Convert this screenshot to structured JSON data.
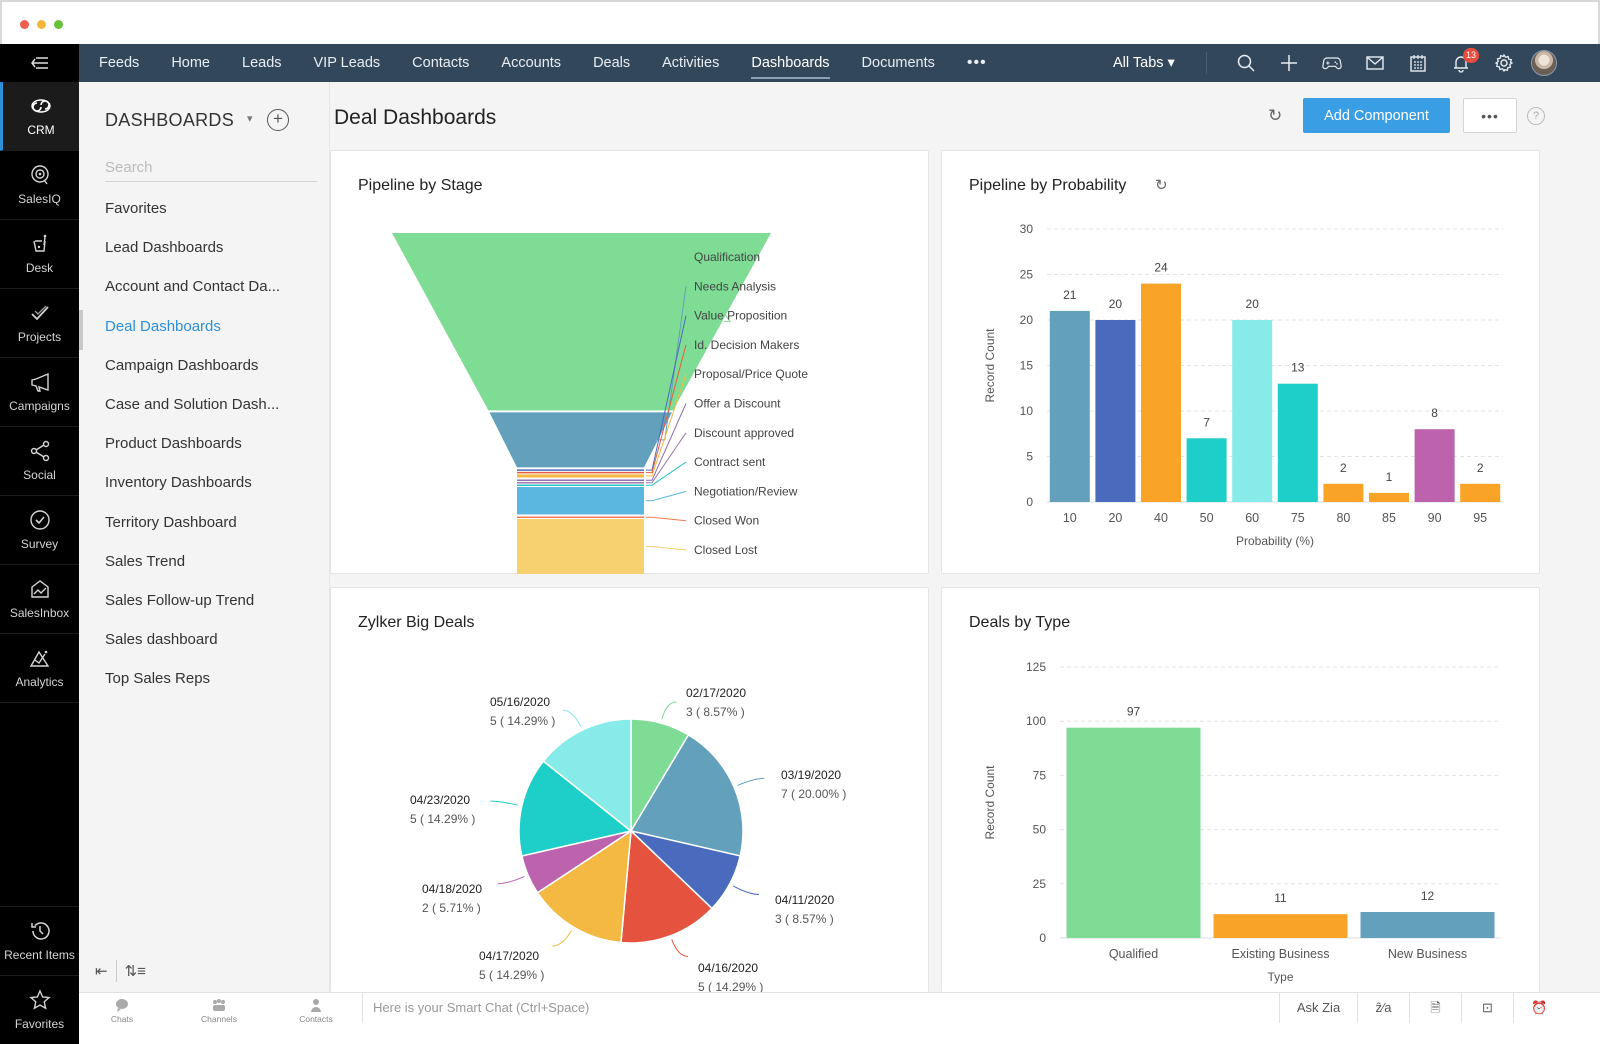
{
  "window": {
    "traffic_lights": [
      "close",
      "minimize",
      "maximize"
    ]
  },
  "app_sidebar": {
    "menu_icon": "menu-collapse-icon",
    "items": [
      {
        "label": "CRM",
        "icon": "crm-icon",
        "active": true
      },
      {
        "label": "SalesIQ",
        "icon": "salesiq-icon",
        "active": false
      },
      {
        "label": "Desk",
        "icon": "desk-icon",
        "active": false
      },
      {
        "label": "Projects",
        "icon": "projects-icon",
        "active": false
      },
      {
        "label": "Campaigns",
        "icon": "campaigns-icon",
        "active": false
      },
      {
        "label": "Social",
        "icon": "social-icon",
        "active": false
      },
      {
        "label": "Survey",
        "icon": "survey-icon",
        "active": false
      },
      {
        "label": "SalesInbox",
        "icon": "salesinbox-icon",
        "active": false
      },
      {
        "label": "Analytics",
        "icon": "analytics-icon",
        "active": false
      }
    ],
    "bottom_items": [
      {
        "label": "Recent Items",
        "icon": "history-icon"
      },
      {
        "label": "Favorites",
        "icon": "star-icon"
      }
    ]
  },
  "topnav": {
    "tabs": [
      {
        "label": "Feeds",
        "active": false
      },
      {
        "label": "Home",
        "active": false
      },
      {
        "label": "Leads",
        "active": false
      },
      {
        "label": "VIP Leads",
        "active": false
      },
      {
        "label": "Contacts",
        "active": false
      },
      {
        "label": "Accounts",
        "active": false
      },
      {
        "label": "Deals",
        "active": false
      },
      {
        "label": "Activities",
        "active": false
      },
      {
        "label": "Dashboards",
        "active": true
      },
      {
        "label": "Documents",
        "active": false
      }
    ],
    "more_label": "•••",
    "all_tabs_label": "All Tabs ▾",
    "icons": [
      "search-icon",
      "plus-icon",
      "gamepad-icon",
      "mail-icon",
      "calendar-icon",
      "bell-icon",
      "gear-icon",
      "avatar"
    ],
    "notification_count": "13"
  },
  "dashboards_panel": {
    "header": "DASHBOARDS",
    "caret": "▾",
    "add": "+",
    "search_placeholder": "Search",
    "search_value": "",
    "items": [
      {
        "label": "Favorites",
        "active": false
      },
      {
        "label": "Lead Dashboards",
        "active": false
      },
      {
        "label": "Account and Contact Da...",
        "active": false
      },
      {
        "label": "Deal Dashboards",
        "active": true
      },
      {
        "label": "Campaign Dashboards",
        "active": false
      },
      {
        "label": "Case and Solution Dash...",
        "active": false
      },
      {
        "label": "Product Dashboards",
        "active": false
      },
      {
        "label": "Inventory Dashboards",
        "active": false
      },
      {
        "label": "Territory Dashboard",
        "active": false
      },
      {
        "label": "Sales Trend",
        "active": false
      },
      {
        "label": "Sales Follow-up Trend",
        "active": false
      },
      {
        "label": "Sales dashboard",
        "active": false
      },
      {
        "label": "Top Sales Reps",
        "active": false
      }
    ],
    "footer": {
      "collapse": "⇤",
      "reorder": "⇅≡"
    }
  },
  "main": {
    "title": "Deal Dashboards",
    "refresh": "↻",
    "add_component_label": "Add Component",
    "more_label": "•••",
    "help_label": "?"
  },
  "chart_data": [
    {
      "id": "pipeline_by_stage",
      "type": "funnel",
      "title": "Pipeline by Stage",
      "categories": [
        "Qualification",
        "Needs Analysis",
        "Value Proposition",
        "Id. Decision Makers",
        "Proposal/Price Quote",
        "Offer a Discount",
        "Discount approved",
        "Contract sent",
        "Negotiation/Review",
        "Closed Won",
        "Closed Lost"
      ],
      "values": [
        58,
        18,
        0,
        0,
        1,
        0,
        0,
        0,
        9,
        0,
        18
      ],
      "colors": [
        "#7edc94",
        "#62a0bb",
        "#4a6bbd",
        "#e85b3e",
        "#f4b942",
        "#8b6fb0",
        "#a07aa8",
        "#26c6c6",
        "#5bb7e0",
        "#f07a54",
        "#f7d070"
      ],
      "legend": "right"
    },
    {
      "id": "pipeline_by_probability",
      "type": "bar",
      "title": "Pipeline by Probability",
      "categories": [
        "10",
        "20",
        "40",
        "50",
        "60",
        "75",
        "80",
        "85",
        "90",
        "95"
      ],
      "values": [
        21,
        20,
        24,
        7,
        20,
        13,
        2,
        1,
        8,
        2
      ],
      "colors": [
        "#62a0bb",
        "#4a6bbd",
        "#f9a327",
        "#1ecec8",
        "#87ebe9",
        "#1ecec8",
        "#f9a327",
        "#f9a327",
        "#bd62ad",
        "#f9a327"
      ],
      "xlabel": "Probability (%)",
      "ylabel": "Record Count",
      "yticks": [
        0,
        5,
        10,
        15,
        20,
        25,
        30
      ],
      "ylim": [
        0,
        30
      ],
      "grid": true
    },
    {
      "id": "zylker_big_deals",
      "type": "pie",
      "title": "Zylker Big Deals",
      "slices": [
        {
          "label": "02/17/2020",
          "value": 3,
          "pct": "8.57%",
          "color": "#7edc94"
        },
        {
          "label": "03/19/2020",
          "value": 7,
          "pct": "20.00%",
          "color": "#62a0bb"
        },
        {
          "label": "04/11/2020",
          "value": 3,
          "pct": "8.57%",
          "color": "#4a6bbd"
        },
        {
          "label": "04/16/2020",
          "value": 5,
          "pct": "14.29%",
          "color": "#e5533e"
        },
        {
          "label": "04/17/2020",
          "value": 5,
          "pct": "14.29%",
          "color": "#f4b942"
        },
        {
          "label": "04/18/2020",
          "value": 2,
          "pct": "5.71%",
          "color": "#bd62ad"
        },
        {
          "label": "04/23/2020",
          "value": 5,
          "pct": "14.29%",
          "color": "#1ecec8"
        },
        {
          "label": "05/16/2020",
          "value": 5,
          "pct": "14.29%",
          "color": "#87ebe9"
        }
      ]
    },
    {
      "id": "deals_by_type",
      "type": "bar",
      "title": "Deals by Type",
      "categories": [
        "Qualified",
        "Existing Business",
        "New Business"
      ],
      "values": [
        97,
        11,
        12
      ],
      "colors": [
        "#7edc94",
        "#f9a327",
        "#62a0bb"
      ],
      "xlabel": "Type",
      "ylabel": "Record Count",
      "yticks": [
        0,
        25,
        50,
        75,
        100,
        125
      ],
      "ylim": [
        0,
        125
      ],
      "grid": true
    }
  ],
  "bottombar": {
    "left_items": [
      {
        "label": "Chats",
        "icon": "chat-icon"
      },
      {
        "label": "Channels",
        "icon": "channels-icon"
      },
      {
        "label": "Contacts",
        "icon": "contact-icon"
      }
    ],
    "smart_chat_placeholder": "Here is your Smart Chat (Ctrl+Space)",
    "ask_zia": "Ask Zia",
    "right_icons": [
      "zia-icon",
      "notes-icon",
      "screen-share-icon",
      "alarm-icon"
    ]
  }
}
